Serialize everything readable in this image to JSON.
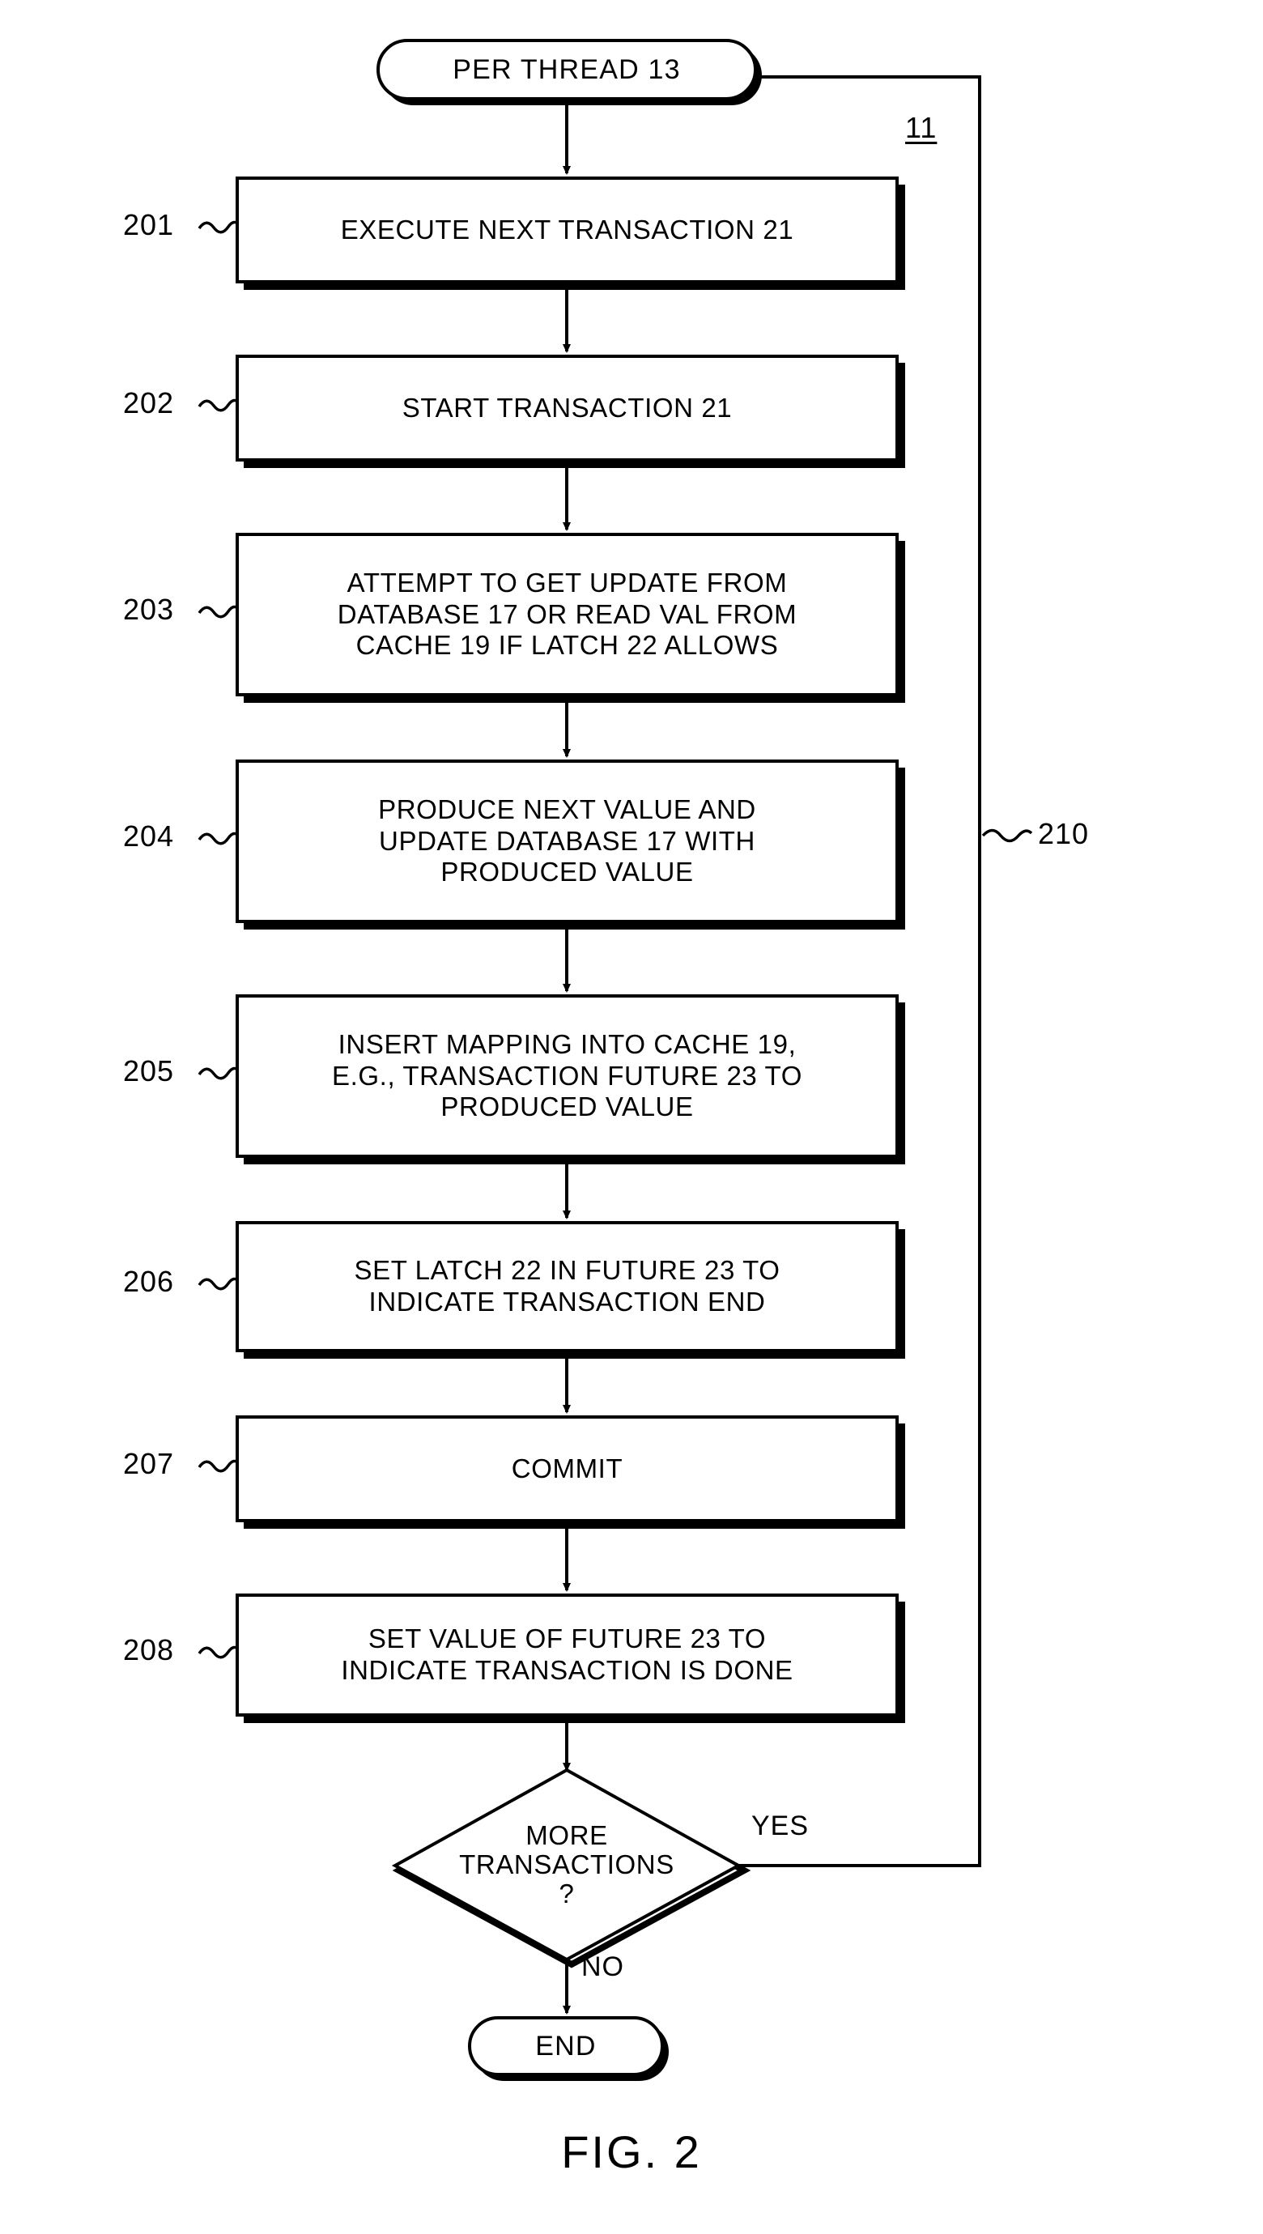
{
  "figure": {
    "caption": "FIG. 2",
    "diagram_ref": "11",
    "loop_ref": "210"
  },
  "nodes": {
    "start_terminal": {
      "label": "PER THREAD 13",
      "shape": "terminal"
    },
    "end_terminal": {
      "label": "END",
      "shape": "terminal"
    },
    "steps": [
      {
        "ref": "201",
        "label": "EXECUTE NEXT TRANSACTION 21",
        "shape": "process"
      },
      {
        "ref": "202",
        "label": "START TRANSACTION 21",
        "shape": "process"
      },
      {
        "ref": "203",
        "label": "ATTEMPT TO GET UPDATE FROM\nDATABASE 17 OR READ VAL FROM\nCACHE 19 IF LATCH 22 ALLOWS",
        "shape": "process"
      },
      {
        "ref": "204",
        "label": "PRODUCE NEXT VALUE AND\nUPDATE DATABASE 17 WITH\nPRODUCED VALUE",
        "shape": "process"
      },
      {
        "ref": "205",
        "label": "INSERT MAPPING INTO CACHE 19,\nE.G., TRANSACTION FUTURE 23 TO\nPRODUCED VALUE",
        "shape": "process"
      },
      {
        "ref": "206",
        "label": "SET LATCH 22 IN FUTURE 23 TO\nINDICATE TRANSACTION END",
        "shape": "process"
      },
      {
        "ref": "207",
        "label": "COMMIT",
        "shape": "process"
      },
      {
        "ref": "208",
        "label": "SET VALUE OF FUTURE 23 TO\nINDICATE TRANSACTION IS DONE",
        "shape": "process"
      }
    ],
    "decision": {
      "label": "MORE\nTRANSACTIONS\n?",
      "shape": "diamond",
      "branch_yes": "YES",
      "branch_no": "NO"
    }
  }
}
